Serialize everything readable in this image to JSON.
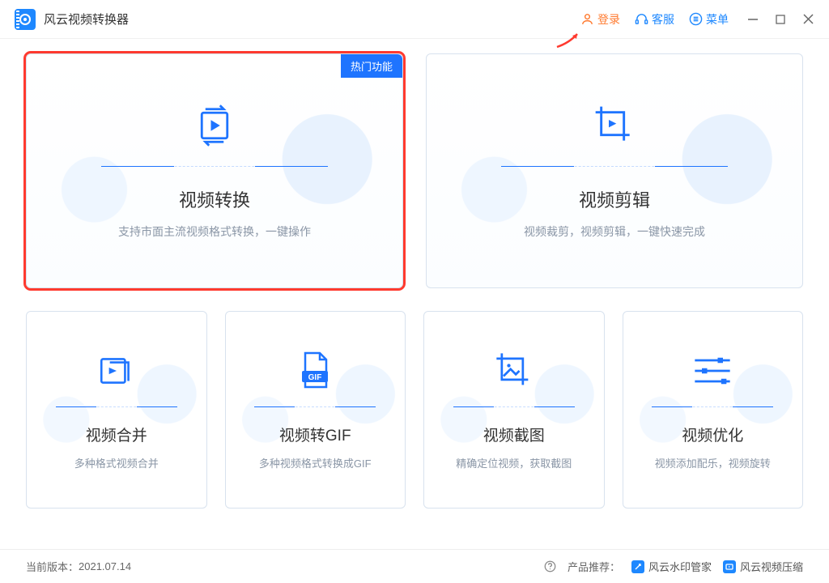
{
  "app": {
    "title": "风云视频转换器"
  },
  "header": {
    "login": "登录",
    "service": "客服",
    "menu": "菜单"
  },
  "hot_badge": "热门功能",
  "cards": {
    "convert": {
      "title": "视频转换",
      "desc": "支持市面主流视频格式转换，一键操作"
    },
    "edit": {
      "title": "视频剪辑",
      "desc": "视频裁剪，视频剪辑，一键快速完成"
    },
    "merge": {
      "title": "视频合并",
      "desc": "多种格式视频合并"
    },
    "gif": {
      "title": "视频转GIF",
      "desc": "多种视频格式转换成GIF",
      "badge": "GIF"
    },
    "shot": {
      "title": "视频截图",
      "desc": "精确定位视频，获取截图"
    },
    "optimize": {
      "title": "视频优化",
      "desc": "视频添加配乐，视频旋转"
    }
  },
  "footer": {
    "version_label": "当前版本：",
    "version": "2021.07.14",
    "recommend_label": "产品推荐：",
    "rec1": "风云水印管家",
    "rec2": "风云视频压缩"
  }
}
